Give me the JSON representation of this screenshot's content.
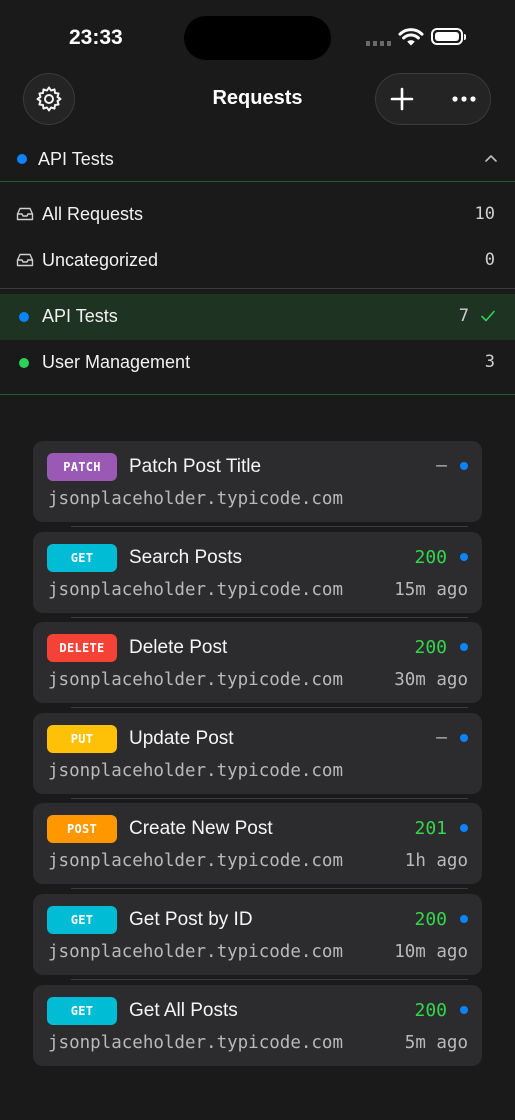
{
  "status_bar": {
    "time": "23:33"
  },
  "header": {
    "title": "Requests"
  },
  "selector": {
    "name": "API Tests",
    "color": "#0a84ff"
  },
  "menu": {
    "all": {
      "label": "All Requests",
      "count": "10"
    },
    "uncategorized": {
      "label": "Uncategorized",
      "count": "0"
    },
    "collections": [
      {
        "label": "API Tests",
        "count": "7",
        "color": "#0a84ff",
        "selected": true
      },
      {
        "label": "User Management",
        "count": "3",
        "color": "#30d158",
        "selected": false
      }
    ]
  },
  "method_colors": {
    "PATCH": "#9b59b6",
    "GET": "#00bcd4",
    "DELETE": "#f44336",
    "PUT": "#ffc107",
    "POST": "#ff9800"
  },
  "requests": [
    {
      "method": "PATCH",
      "title": "Patch Post Title",
      "status": "–",
      "host": "jsonplaceholder.typicode.com",
      "time": ""
    },
    {
      "method": "GET",
      "title": "Search Posts",
      "status": "200",
      "host": "jsonplaceholder.typicode.com",
      "time": "15m ago"
    },
    {
      "method": "DELETE",
      "title": "Delete Post",
      "status": "200",
      "host": "jsonplaceholder.typicode.com",
      "time": "30m ago"
    },
    {
      "method": "PUT",
      "title": "Update Post",
      "status": "–",
      "host": "jsonplaceholder.typicode.com",
      "time": ""
    },
    {
      "method": "POST",
      "title": "Create New Post",
      "status": "201",
      "host": "jsonplaceholder.typicode.com",
      "time": "1h ago"
    },
    {
      "method": "GET",
      "title": "Get Post by ID",
      "status": "200",
      "host": "jsonplaceholder.typicode.com",
      "time": "10m ago"
    },
    {
      "method": "GET",
      "title": "Get All Posts",
      "status": "200",
      "host": "jsonplaceholder.typicode.com",
      "time": "5m ago"
    }
  ],
  "icons": {
    "settings": "gear-icon",
    "add": "plus-icon",
    "more": "ellipsis-icon",
    "collapse": "chevron-up-icon",
    "inbox": "tray-icon",
    "selected": "checkmark-icon"
  }
}
